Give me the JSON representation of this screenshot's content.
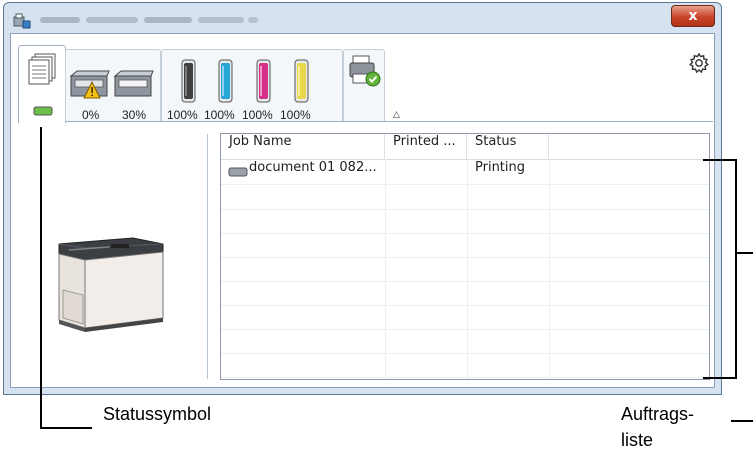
{
  "window": {
    "close_label": "x"
  },
  "toolbar": {
    "tabs": [
      {
        "icon": "print-queue-icon",
        "selected": true
      },
      {
        "icon": "paper-tray-warning-icon",
        "level": "0%"
      },
      {
        "icon": "paper-tray-icon",
        "level": "30%"
      },
      {
        "icon": "toner-black-icon",
        "level": "100%",
        "color": "#404040"
      },
      {
        "icon": "toner-cyan-icon",
        "level": "100%",
        "color": "#27a6d8"
      },
      {
        "icon": "toner-magenta-icon",
        "level": "100%",
        "color": "#d6318a"
      },
      {
        "icon": "toner-yellow-icon",
        "level": "100%",
        "color": "#e9d84b"
      },
      {
        "icon": "printer-ready-icon"
      }
    ],
    "status_symbol": {
      "icon": "status-indicator-icon",
      "color": "#6dbe4b"
    },
    "collapse_icon": "chevron-up-icon",
    "settings_icon": "gear-icon"
  },
  "job_list": {
    "columns": [
      "Job Name",
      "Printed ...",
      "Status"
    ],
    "rows": [
      {
        "job_name": "document 01 082...",
        "printed": "",
        "status": "Printing"
      }
    ]
  },
  "callouts": {
    "status_symbol": "Statussymbol",
    "job_list_line1": "Auftrags-",
    "job_list_line2": "liste"
  }
}
